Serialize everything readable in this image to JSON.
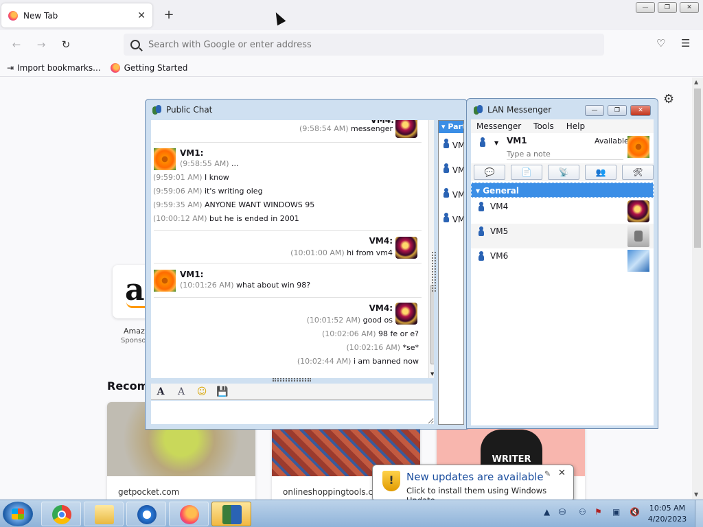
{
  "browser": {
    "tab_title": "New Tab",
    "tab_close": "✕",
    "new_tab": "+",
    "url_placeholder": "Search with Google or enter address",
    "bookmarks": [
      {
        "label": "Import bookmarks..."
      },
      {
        "label": "Getting Started"
      }
    ],
    "window_controls": [
      "—",
      "❐",
      "✕"
    ]
  },
  "page": {
    "top_site": {
      "label": "Amaz",
      "sub": "Sponso"
    },
    "recommend_heading": "Recomm",
    "cards": [
      {
        "site": "getpocket.com",
        "image_color": "#bdb8ae"
      },
      {
        "site": "onlineshoppingtools.co",
        "image_color": "#8a4d3f"
      },
      {
        "site": "",
        "image_text": "WRITER",
        "image_color": "#f8b6ae"
      }
    ]
  },
  "public_chat": {
    "title": "Public Chat",
    "participants_header": "Part",
    "participants": [
      "VM",
      "VM",
      "VM",
      "VM"
    ],
    "messages": [
      {
        "sender": "VM4:",
        "side": "right",
        "lines": [
          {
            "time": "(9:58:54 AM)",
            "text": " messenger"
          }
        ]
      },
      {
        "sender": "VM1:",
        "side": "left",
        "lines": [
          {
            "time": "(9:58:55 AM)",
            "text": " ..."
          },
          {
            "time": "(9:59:01 AM)",
            "text": " I know"
          },
          {
            "time": "(9:59:06 AM)",
            "text": " it's writing oleg"
          },
          {
            "time": "(9:59:35 AM)",
            "text": " ANYONE WANT WINDOWS 95"
          },
          {
            "time": "(10:00:12 AM)",
            "text": " but he is ended in 2001"
          }
        ]
      },
      {
        "sender": "VM4:",
        "side": "right",
        "lines": [
          {
            "time": "(10:01:00 AM)",
            "text": " hi from vm4"
          }
        ]
      },
      {
        "sender": "VM1:",
        "side": "left",
        "lines": [
          {
            "time": "(10:01:26 AM)",
            "text": " what about win 98?"
          }
        ]
      },
      {
        "sender": "VM4:",
        "side": "right",
        "lines": [
          {
            "time": "(10:01:52 AM)",
            "text": " good os"
          },
          {
            "time": "(10:02:06 AM)",
            "text": " 98 fe or e?"
          },
          {
            "time": "(10:02:16 AM)",
            "text": " *se*"
          },
          {
            "time": "(10:02:44 AM)",
            "text": " i am banned now"
          }
        ]
      }
    ],
    "toolbar": {
      "font": "A",
      "font_style": "A",
      "emoticon": "☺",
      "save": "💾"
    },
    "input_value": ""
  },
  "lan_messenger": {
    "title": "LAN Messenger",
    "menu": [
      "Messenger",
      "Tools",
      "Help"
    ],
    "user_name": "VM1",
    "status": "Available",
    "note_placeholder": "Type a note",
    "group": "General",
    "contacts": [
      {
        "name": "VM4"
      },
      {
        "name": "VM5"
      },
      {
        "name": "VM6"
      }
    ],
    "window_controls": [
      "—",
      "❐",
      "✕"
    ]
  },
  "notification": {
    "title": "New updates are available",
    "text": "Click to install them using Windows Update.",
    "icon": "!"
  },
  "taskbar": {
    "time": "10:05 AM",
    "date": "4/20/2023",
    "tray_icons": [
      "arrow-up-icon",
      "lan-messenger-tray-icon",
      "flag-icon",
      "network-icon",
      "volume-muted-icon"
    ]
  }
}
